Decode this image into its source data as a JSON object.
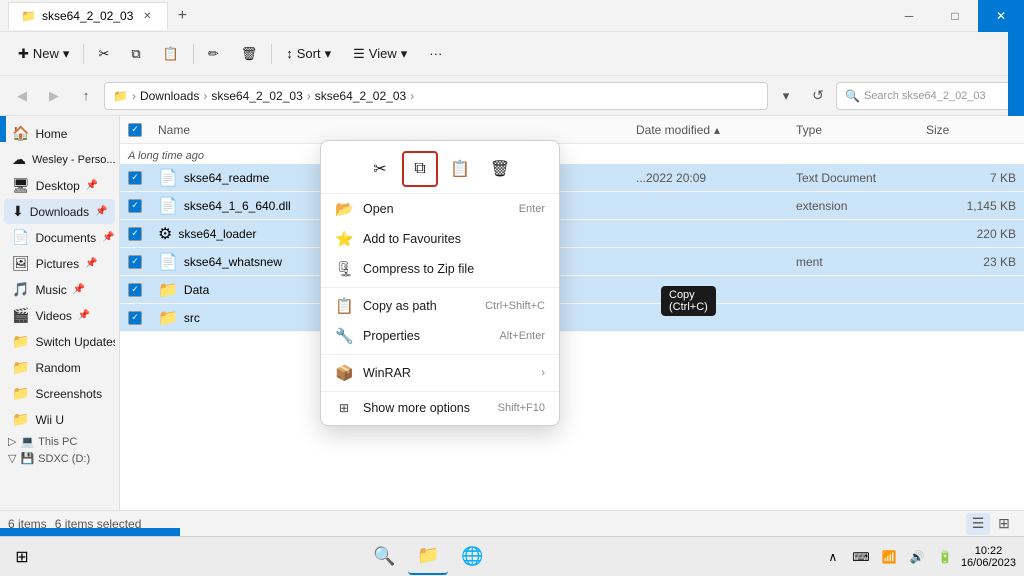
{
  "window": {
    "title": "skse64_2_02_03",
    "tabs": [
      {
        "label": "skse64_2_02_03",
        "active": true
      }
    ]
  },
  "toolbar": {
    "new_label": "New",
    "cut_label": "✂",
    "copy_label": "⧉",
    "paste_label": "📋",
    "rename_label": "✏",
    "delete_label": "🗑",
    "sort_label": "Sort",
    "view_label": "View",
    "more_label": "···"
  },
  "addressbar": {
    "path_parts": [
      "Downloads",
      "skse64_2_02_03",
      "skse64_2_02_03"
    ],
    "search_placeholder": "Search skse64_2_02_03",
    "breadcrumb_icon": "📁"
  },
  "sidebar": {
    "items": [
      {
        "id": "home",
        "label": "Home",
        "icon": "🏠",
        "pin": false
      },
      {
        "id": "wesley",
        "label": "Wesley - Perso...",
        "icon": "☁",
        "pin": false
      },
      {
        "id": "desktop",
        "label": "Desktop",
        "icon": "🖥",
        "pin": true
      },
      {
        "id": "downloads",
        "label": "Downloads",
        "icon": "⬇",
        "pin": true,
        "active": true
      },
      {
        "id": "documents",
        "label": "Documents",
        "icon": "📄",
        "pin": true
      },
      {
        "id": "pictures",
        "label": "Pictures",
        "icon": "🖼",
        "pin": true
      },
      {
        "id": "music",
        "label": "Music",
        "icon": "🎵",
        "pin": true
      },
      {
        "id": "videos",
        "label": "Videos",
        "icon": "🎬",
        "pin": true
      },
      {
        "id": "switch-updates",
        "label": "Switch Updates",
        "icon": "📁",
        "pin": false
      },
      {
        "id": "random",
        "label": "Random",
        "icon": "📁",
        "pin": false
      },
      {
        "id": "screenshots",
        "label": "Screenshots",
        "icon": "📁",
        "pin": false
      },
      {
        "id": "wiiu",
        "label": "Wii U",
        "icon": "📁",
        "pin": false
      },
      {
        "id": "thispc",
        "label": "This PC",
        "icon": "💻",
        "pin": false,
        "collapsed": true
      },
      {
        "id": "sdxc",
        "label": "SDXC (D:)",
        "icon": "💾",
        "pin": false
      }
    ]
  },
  "file_section": {
    "section_label": "A long time ago",
    "columns": {
      "name": "Name",
      "date_modified": "Date modified",
      "type": "Type",
      "size": "Size"
    },
    "files": [
      {
        "name": "skse64_readme",
        "icon": "📄",
        "date": "...2022 20:09",
        "type": "Text Document",
        "size": "7 KB",
        "selected": true
      },
      {
        "name": "skse64_1_6_640.dll",
        "icon": "📄",
        "date": "",
        "type": "extension",
        "size": "1,145 KB",
        "selected": true
      },
      {
        "name": "skse64_loader",
        "icon": "⚙",
        "date": "",
        "type": "",
        "size": "220 KB",
        "selected": true
      },
      {
        "name": "skse64_whatsnew",
        "icon": "📄",
        "date": "",
        "type": "ment",
        "size": "23 KB",
        "selected": true
      },
      {
        "name": "Data",
        "icon": "📁",
        "date": "",
        "type": "",
        "size": "",
        "selected": true
      },
      {
        "name": "src",
        "icon": "📁",
        "date": "",
        "type": "",
        "size": "",
        "selected": true
      }
    ]
  },
  "context_menu": {
    "copy_tooltip": "Copy (Ctrl+C)",
    "clipboard_icons": [
      {
        "id": "cut",
        "icon": "✂",
        "label": "Cut"
      },
      {
        "id": "copy",
        "icon": "⧉",
        "label": "Copy",
        "highlighted": true
      },
      {
        "id": "paste",
        "icon": "📋",
        "label": "Paste"
      },
      {
        "id": "delete",
        "icon": "🗑",
        "label": "Delete"
      }
    ],
    "items": [
      {
        "id": "open",
        "icon": "📂",
        "label": "Open",
        "shortcut": "Enter"
      },
      {
        "id": "add-favourites",
        "icon": "⭐",
        "label": "Add to Favourites",
        "shortcut": ""
      },
      {
        "id": "compress",
        "icon": "🗜",
        "label": "Compress to Zip file",
        "shortcut": ""
      },
      {
        "id": "copy-path",
        "icon": "📋",
        "label": "Copy as path",
        "shortcut": "Ctrl+Shift+C"
      },
      {
        "id": "properties",
        "icon": "🔑",
        "label": "Properties",
        "shortcut": "Alt+Enter"
      },
      {
        "id": "winrar",
        "icon": "📦",
        "label": "WinRAR",
        "shortcut": "",
        "arrow": "›"
      },
      {
        "id": "more-options",
        "icon": "⬛",
        "label": "Show more options",
        "shortcut": "Shift+F10"
      }
    ]
  },
  "statusbar": {
    "count_label": "6 items",
    "selected_label": "6 items selected"
  },
  "taskbar": {
    "start_icon": "⊞",
    "apps": [
      {
        "id": "search",
        "icon": "🔍"
      },
      {
        "id": "explorer",
        "icon": "📁",
        "active": true
      },
      {
        "id": "chrome",
        "icon": "🌐"
      }
    ],
    "tray": {
      "chevron": "∧",
      "keyboard": "⌨",
      "network": "🔊",
      "wifi": "📶",
      "battery": "🔋",
      "time": "10:22",
      "date": "16/06/2023"
    }
  }
}
